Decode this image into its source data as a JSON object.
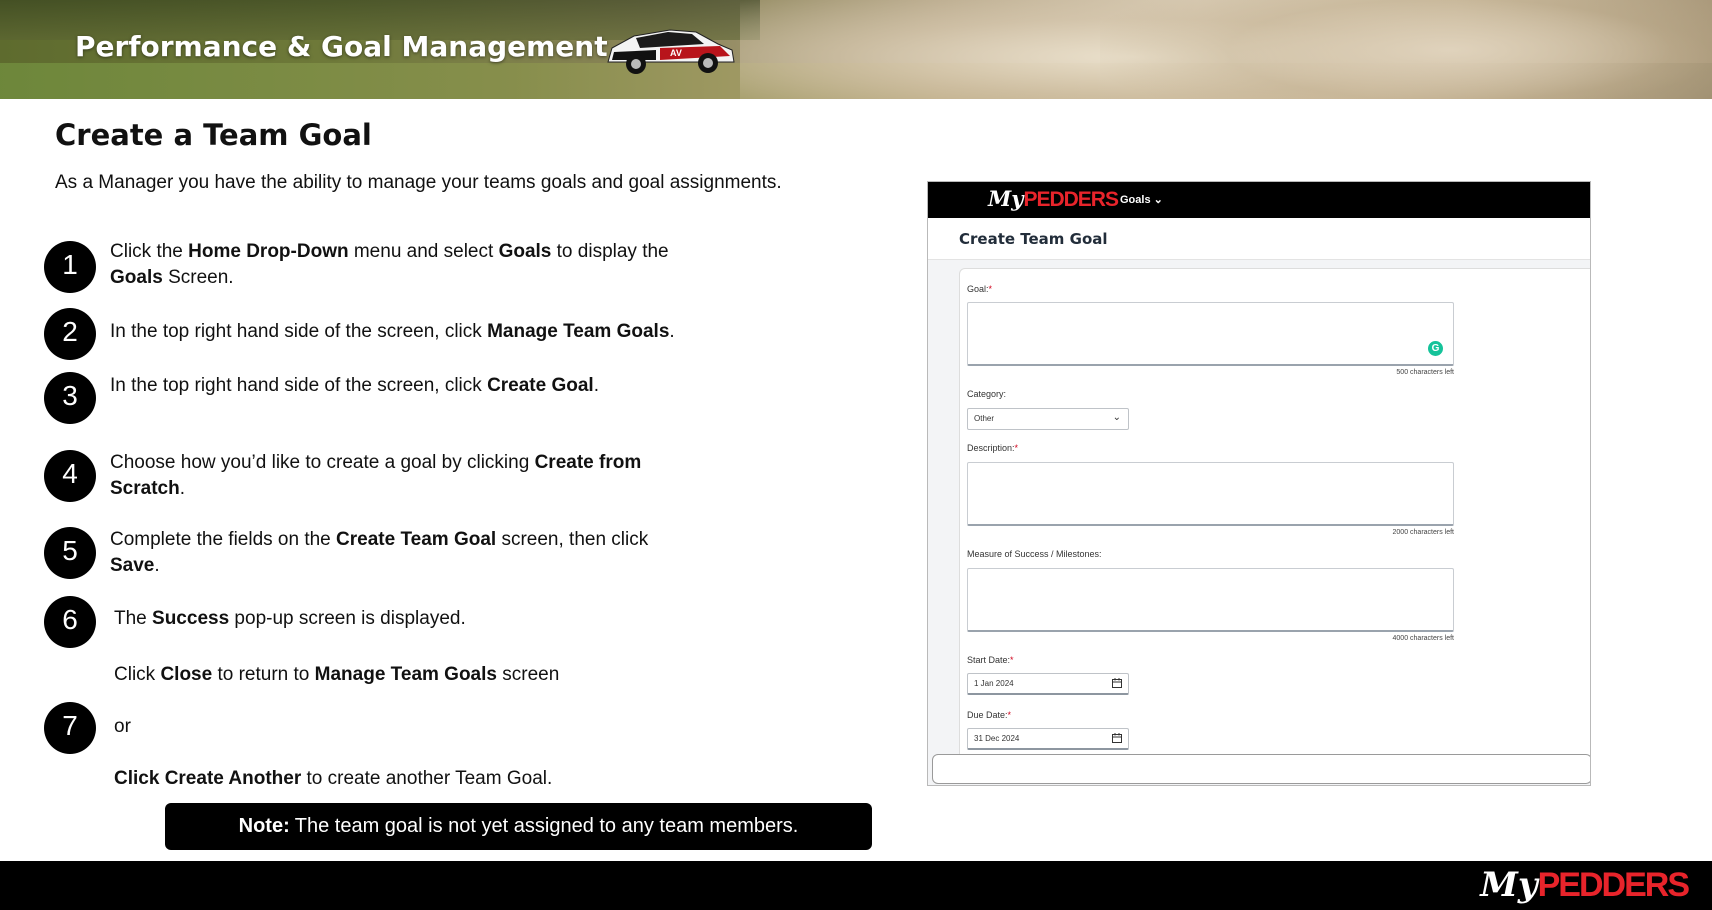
{
  "banner": {
    "title": "Performance & Goal Management",
    "car_decal": "AV"
  },
  "page": {
    "title": "Create a Team Goal",
    "intro": "As a Manager you have the ability to manage your teams goals and goal assignments."
  },
  "steps": [
    {
      "num": "1",
      "parts": [
        {
          "t": "Click the "
        },
        {
          "t": "Home Drop-Down",
          "b": true
        },
        {
          "t": " menu and select "
        },
        {
          "t": "Goals",
          "b": true
        },
        {
          "t": " to display the "
        },
        {
          "br": true
        },
        {
          "t": "Goals",
          "b": true
        },
        {
          "t": " Screen."
        }
      ]
    },
    {
      "num": "2",
      "parts": [
        {
          "t": "In the top right hand side of the screen, click "
        },
        {
          "t": "Manage Team Goals",
          "b": true
        },
        {
          "t": "."
        }
      ]
    },
    {
      "num": "3",
      "parts": [
        {
          "t": "In the top right hand side of the screen, click "
        },
        {
          "t": "Create Goal",
          "b": true
        },
        {
          "t": "."
        }
      ]
    },
    {
      "num": "4",
      "parts": [
        {
          "t": "Choose how you’d like to create a goal by clicking "
        },
        {
          "t": "Create from",
          "b": true
        },
        {
          "br": true
        },
        {
          "t": "Scratch",
          "b": true
        },
        {
          "t": "."
        }
      ]
    },
    {
      "num": "5",
      "parts": [
        {
          "t": "Complete the fields on the "
        },
        {
          "t": "Create Team Goal",
          "b": true
        },
        {
          "t": " screen, then click"
        },
        {
          "br": true
        },
        {
          "t": "Save",
          "b": true
        },
        {
          "t": "."
        }
      ]
    },
    {
      "num": "6",
      "parts": [
        {
          "t": "The "
        },
        {
          "t": "Success",
          "b": true
        },
        {
          "t": " pop-up screen is displayed."
        }
      ]
    },
    {
      "num": "",
      "parts": [
        {
          "t": "Click "
        },
        {
          "t": "Close",
          "b": true
        },
        {
          "t": " to return to "
        },
        {
          "t": "Manage Team Goals",
          "b": true
        },
        {
          "t": " screen"
        }
      ]
    },
    {
      "num": "7",
      "parts": [
        {
          "t": "or"
        }
      ]
    },
    {
      "num": "",
      "parts": [
        {
          "t": "Click Create Another",
          "b": true
        },
        {
          "t": " to create another Team Goal."
        }
      ]
    }
  ],
  "note": {
    "label": "Note:",
    "text": "The team goal is not yet assigned to any team members."
  },
  "screenshot": {
    "logo_my": "My",
    "logo_pedders": "PEDDERS",
    "nav_menu": "Goals",
    "title": "Create Team Goal",
    "fields": {
      "goal_label": "Goal:",
      "goal_count": "500 characters left",
      "category_label": "Category:",
      "category_value": "Other",
      "description_label": "Description:",
      "description_count": "2000 characters left",
      "measure_label": "Measure of Success / Milestones:",
      "measure_count": "4000 characters left",
      "start_label": "Start Date:",
      "start_value": "1 Jan 2024",
      "due_label": "Due Date:",
      "due_value": "31 Dec 2024"
    },
    "required_mark": "*",
    "grammarly": "G"
  },
  "footer": {
    "logo_my": "My",
    "logo_pedders": "PEDDERS"
  },
  "colors": {
    "brand_red": "#e8242b",
    "black": "#000000",
    "required": "#d0021b",
    "grammarly": "#15c39a"
  },
  "icons": [
    "chevron-down-icon",
    "calendar-icon",
    "grammarly-icon"
  ]
}
